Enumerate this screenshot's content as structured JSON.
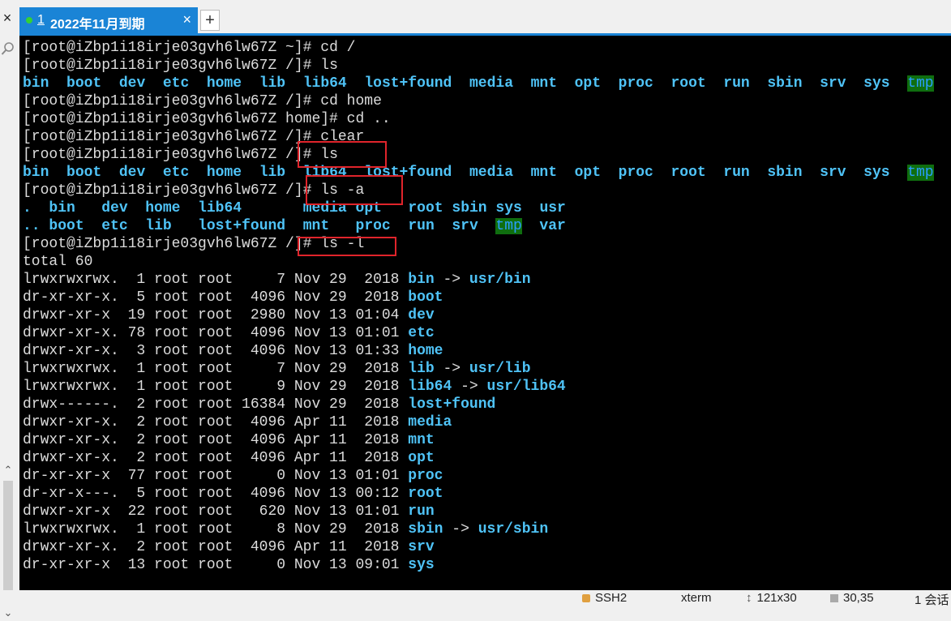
{
  "tab": {
    "number": "1",
    "title": "2022年11月到期",
    "close": "×",
    "add": "+"
  },
  "window": {
    "close": "×"
  },
  "terminal": {
    "prompt_home": "[root@iZbp1i18irje03gvh6lw67Z ~]# ",
    "prompt_root": "[root@iZbp1i18irje03gvh6lw67Z /]# ",
    "prompt_in_home": "[root@iZbp1i18irje03gvh6lw67Z home]# ",
    "cmd_cd_root": "cd /",
    "cmd_ls": "ls",
    "cmd_cd_home": "cd home",
    "cmd_cd_up": "cd ..",
    "cmd_clear": "clear",
    "cmd_ls_a": "ls -a",
    "cmd_ls_l": "ls -l",
    "ls_row": [
      "bin",
      "boot",
      "dev",
      "etc",
      "home",
      "lib",
      "lib64",
      "lost+found",
      "media",
      "mnt",
      "opt",
      "proc",
      "root",
      "run",
      "sbin",
      "srv",
      "sys",
      "tmp"
    ],
    "ls_a_row1": [
      ".",
      "bin",
      "dev",
      "home",
      "lib64",
      "media",
      "opt",
      "root",
      "sbin",
      "sys",
      "usr"
    ],
    "ls_a_row2": [
      "..",
      "boot",
      "etc",
      "lib",
      "lost+found",
      "mnt",
      "proc",
      "run",
      "srv",
      "tmp",
      "var"
    ],
    "total": "total 60",
    "ls_l": [
      {
        "perm": "lrwxrwxrwx.",
        "links": "1",
        "owner": "root",
        "group": "root",
        "size": "7",
        "month": "Nov",
        "day": "29",
        "time": "2018",
        "name": "bin",
        "target": "usr/bin"
      },
      {
        "perm": "dr-xr-xr-x.",
        "links": "5",
        "owner": "root",
        "group": "root",
        "size": "4096",
        "month": "Nov",
        "day": "29",
        "time": "2018",
        "name": "boot",
        "target": ""
      },
      {
        "perm": "drwxr-xr-x",
        "links": "19",
        "owner": "root",
        "group": "root",
        "size": "2980",
        "month": "Nov",
        "day": "13",
        "time": "01:04",
        "name": "dev",
        "target": ""
      },
      {
        "perm": "drwxr-xr-x.",
        "links": "78",
        "owner": "root",
        "group": "root",
        "size": "4096",
        "month": "Nov",
        "day": "13",
        "time": "01:01",
        "name": "etc",
        "target": ""
      },
      {
        "perm": "drwxr-xr-x.",
        "links": "3",
        "owner": "root",
        "group": "root",
        "size": "4096",
        "month": "Nov",
        "day": "13",
        "time": "01:33",
        "name": "home",
        "target": ""
      },
      {
        "perm": "lrwxrwxrwx.",
        "links": "1",
        "owner": "root",
        "group": "root",
        "size": "7",
        "month": "Nov",
        "day": "29",
        "time": "2018",
        "name": "lib",
        "target": "usr/lib"
      },
      {
        "perm": "lrwxrwxrwx.",
        "links": "1",
        "owner": "root",
        "group": "root",
        "size": "9",
        "month": "Nov",
        "day": "29",
        "time": "2018",
        "name": "lib64",
        "target": "usr/lib64"
      },
      {
        "perm": "drwx------.",
        "links": "2",
        "owner": "root",
        "group": "root",
        "size": "16384",
        "month": "Nov",
        "day": "29",
        "time": "2018",
        "name": "lost+found",
        "target": ""
      },
      {
        "perm": "drwxr-xr-x.",
        "links": "2",
        "owner": "root",
        "group": "root",
        "size": "4096",
        "month": "Apr",
        "day": "11",
        "time": "2018",
        "name": "media",
        "target": ""
      },
      {
        "perm": "drwxr-xr-x.",
        "links": "2",
        "owner": "root",
        "group": "root",
        "size": "4096",
        "month": "Apr",
        "day": "11",
        "time": "2018",
        "name": "mnt",
        "target": ""
      },
      {
        "perm": "drwxr-xr-x.",
        "links": "2",
        "owner": "root",
        "group": "root",
        "size": "4096",
        "month": "Apr",
        "day": "11",
        "time": "2018",
        "name": "opt",
        "target": ""
      },
      {
        "perm": "dr-xr-xr-x",
        "links": "77",
        "owner": "root",
        "group": "root",
        "size": "0",
        "month": "Nov",
        "day": "13",
        "time": "01:01",
        "name": "proc",
        "target": ""
      },
      {
        "perm": "dr-xr-x---.",
        "links": "5",
        "owner": "root",
        "group": "root",
        "size": "4096",
        "month": "Nov",
        "day": "13",
        "time": "00:12",
        "name": "root",
        "target": ""
      },
      {
        "perm": "drwxr-xr-x",
        "links": "22",
        "owner": "root",
        "group": "root",
        "size": "620",
        "month": "Nov",
        "day": "13",
        "time": "01:01",
        "name": "run",
        "target": ""
      },
      {
        "perm": "lrwxrwxrwx.",
        "links": "1",
        "owner": "root",
        "group": "root",
        "size": "8",
        "month": "Nov",
        "day": "29",
        "time": "2018",
        "name": "sbin",
        "target": "usr/sbin"
      },
      {
        "perm": "drwxr-xr-x.",
        "links": "2",
        "owner": "root",
        "group": "root",
        "size": "4096",
        "month": "Apr",
        "day": "11",
        "time": "2018",
        "name": "srv",
        "target": ""
      },
      {
        "perm": "dr-xr-xr-x",
        "links": "13",
        "owner": "root",
        "group": "root",
        "size": "0",
        "month": "Nov",
        "day": "13",
        "time": "09:01",
        "name": "sys",
        "target": ""
      }
    ]
  },
  "status": {
    "protocol": "SSH2",
    "term": "xterm",
    "size": "121x30",
    "cursor": "30,35",
    "sessions": "1 会话"
  },
  "colors": {
    "tab_bg": "#1a84d6",
    "dir": "#4fc3f7",
    "tmp_bg": "#0f6e0f",
    "highlight": "#e0242b",
    "terminal_bg": "#000000"
  }
}
